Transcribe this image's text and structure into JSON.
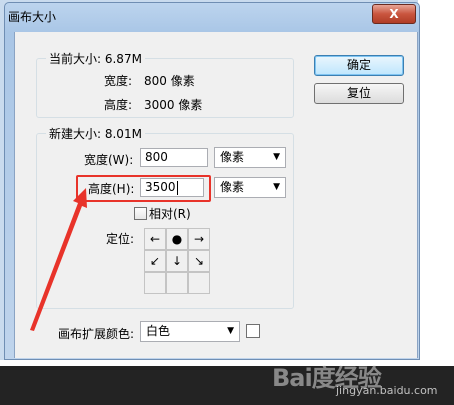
{
  "window": {
    "title": "画布大小",
    "close_label": "X"
  },
  "current_size": {
    "legend": "当前大小: 6.87M",
    "width_label": "宽度:",
    "width_value": "800 像素",
    "height_label": "高度:",
    "height_value": "3000 像素"
  },
  "new_size": {
    "legend": "新建大小: 8.01M",
    "width_label": "宽度(W):",
    "width_value": "800",
    "width_unit": "像素",
    "height_label": "高度(H):",
    "height_value": "3500",
    "height_unit": "像素",
    "relative_label": "相对(R)",
    "relative_checked": false,
    "anchor_label": "定位:",
    "anchor_cells": [
      "←",
      "●",
      "→",
      "↙",
      "↓",
      "↘",
      "",
      "",
      ""
    ]
  },
  "buttons": {
    "ok": "确定",
    "reset": "复位"
  },
  "extension": {
    "label": "画布扩展颜色:",
    "value": "白色"
  },
  "watermark": {
    "logo": "Bai度经验",
    "url": "jingyan.baidu.com"
  },
  "colors": {
    "highlight": "#e8332a",
    "title_bar": "#bcd4ee"
  }
}
